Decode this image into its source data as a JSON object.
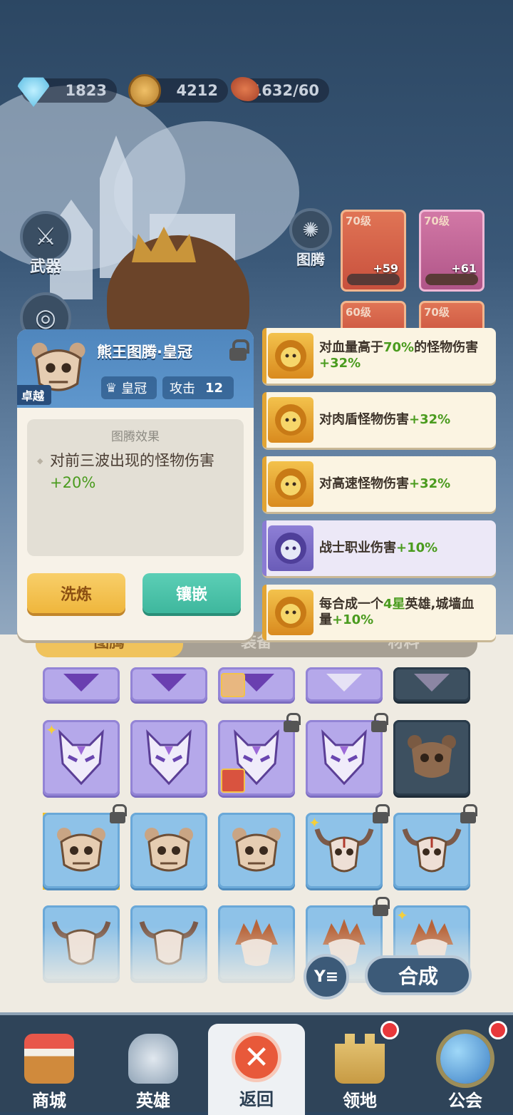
{
  "currencies": {
    "gems": "1823",
    "coins": "4212",
    "stamina": "1632/60"
  },
  "side_buttons": {
    "weapon": "武器",
    "totem": "图腾"
  },
  "gear_cards": [
    {
      "level": "70级",
      "plus": "+59",
      "color": "#d9634a"
    },
    {
      "level": "70级",
      "plus": "+61",
      "color": "#c25a8a"
    },
    {
      "level": "60级",
      "color": "#d9634a"
    },
    {
      "level": "70级",
      "color": "#d9634a"
    }
  ],
  "detail": {
    "title": "熊王图腾·皇冠",
    "grade": "卓越",
    "slot_label": "皇冠",
    "attack_label": "攻击",
    "attack_value": "12",
    "effect_title": "图腾效果",
    "effect_prefix": "对前三波出现的怪物伤害",
    "effect_value": "+20%",
    "refine_button": "洗炼",
    "inlay_button": "镶嵌"
  },
  "attributes": [
    {
      "text": "对血量高于",
      "highlight": "70%",
      "text2": "的怪物伤害",
      "value": "+32%",
      "style": "gold",
      "icon": "lion-icon"
    },
    {
      "text": "对肉盾怪物伤害",
      "value": "+32%",
      "style": "gold",
      "icon": "lion-icon"
    },
    {
      "text": "对高速怪物伤害",
      "value": "+32%",
      "style": "gold",
      "icon": "lion-icon"
    },
    {
      "text": "战士职业伤害",
      "value": "+10%",
      "style": "purple",
      "icon": "tiger-icon"
    },
    {
      "text": "每合成一个",
      "highlight": "4星",
      "text2": "英雄,城墙血量",
      "value": "+10%",
      "style": "gold",
      "icon": "lion-icon"
    }
  ],
  "tabs": [
    "图腾",
    "装备",
    "材料"
  ],
  "actions": {
    "filter": "Y≡",
    "merge": "合成"
  },
  "nav": [
    "商城",
    "英雄",
    "返回",
    "领地",
    "公会"
  ],
  "colors": {
    "accent_gold": "#f0c35c",
    "green": "#4a9b1e",
    "panel_blue": "#4f86bd"
  }
}
